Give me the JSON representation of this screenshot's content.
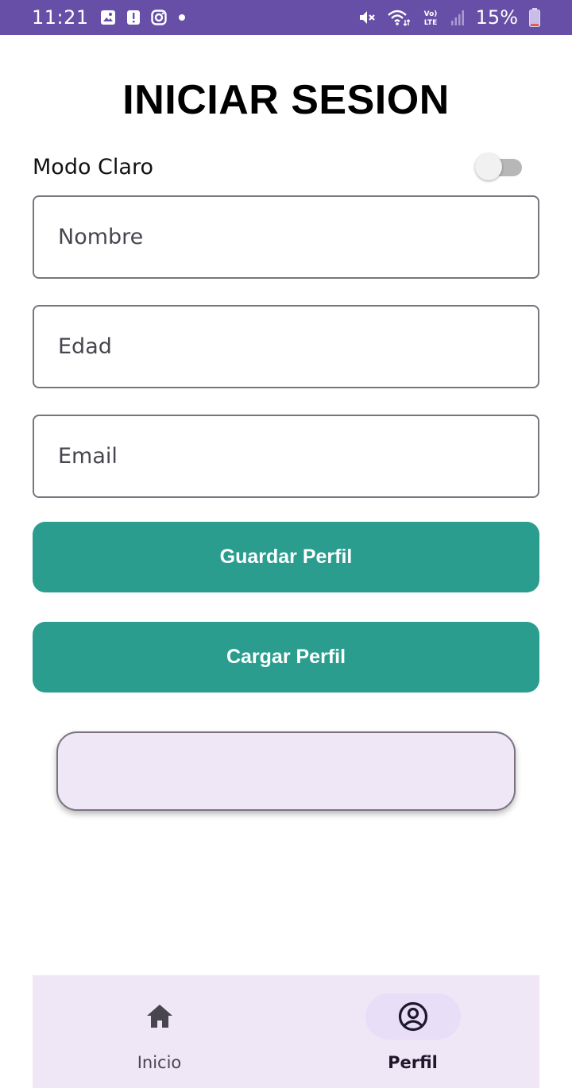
{
  "status_bar": {
    "time": "11:21",
    "battery_percent": "15%",
    "left_icons": [
      "gallery-icon",
      "alert-icon",
      "instagram-icon",
      "dot-icon"
    ],
    "right_icons": [
      "mute-icon",
      "wifi-icon",
      "volte-icon",
      "signal-icon",
      "battery-icon"
    ],
    "volte_label": "Vo)) LTE",
    "background_color": "#674ea7",
    "battery_level": 0.15
  },
  "header": {
    "title": "INICIAR SESION"
  },
  "theme_toggle": {
    "label": "Modo Claro",
    "checked": false
  },
  "form": {
    "name": {
      "value": "",
      "placeholder": "Nombre"
    },
    "age": {
      "value": "",
      "placeholder": "Edad"
    },
    "email": {
      "value": "",
      "placeholder": "Email"
    }
  },
  "actions": {
    "save_label": "Guardar Perfil",
    "load_label": "Cargar Perfil",
    "button_color": "#2a9d8f"
  },
  "result_card": {
    "text": ""
  },
  "bottom_nav": {
    "items": [
      {
        "label": "Inicio",
        "icon": "home-icon",
        "active": false
      },
      {
        "label": "Perfil",
        "icon": "account-circle-icon",
        "active": true
      }
    ],
    "background_color": "#efe6f6"
  }
}
